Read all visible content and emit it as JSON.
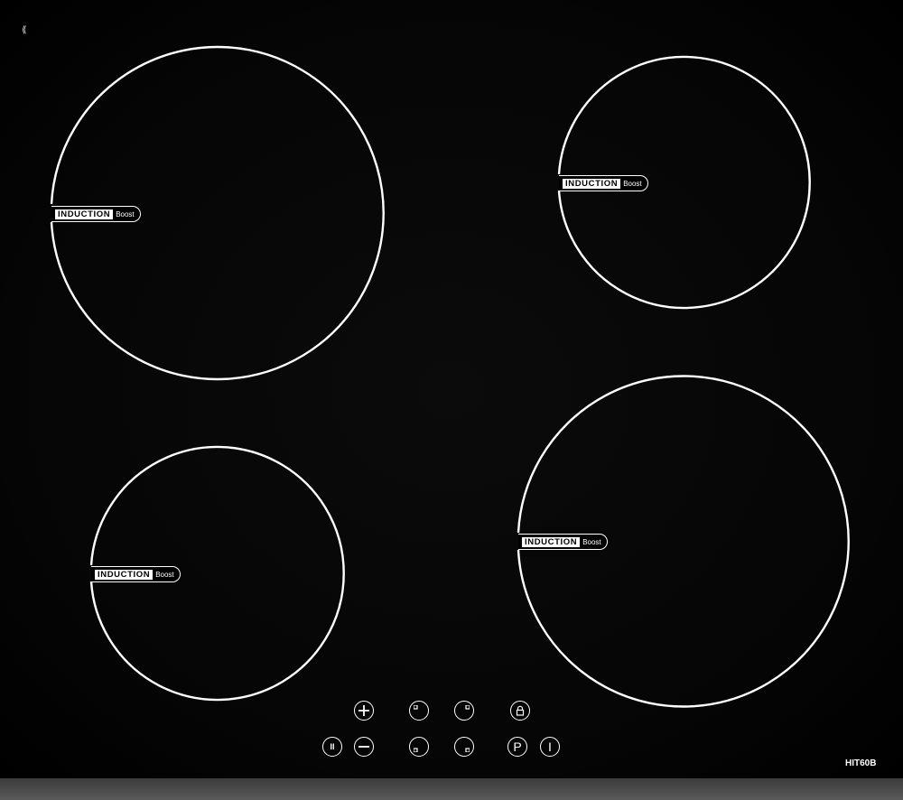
{
  "zones": [
    {
      "label": "INDUCTION",
      "boost": "Boost"
    },
    {
      "label": "INDUCTION",
      "boost": "Boost"
    },
    {
      "label": "INDUCTION",
      "boost": "Boost"
    },
    {
      "label": "INDUCTION",
      "boost": "Boost"
    }
  ],
  "controls": {
    "plus_icon": "plus-icon",
    "minus_icon": "minus-icon",
    "pause_icon": "pause-icon",
    "lock_icon": "lock-icon",
    "power_icon": "power-icon",
    "pause_text": "II",
    "p_text": "P",
    "power_text": "I"
  },
  "model": "HIT60B",
  "colors": {
    "glass": "#000000",
    "print": "#ffffff"
  }
}
